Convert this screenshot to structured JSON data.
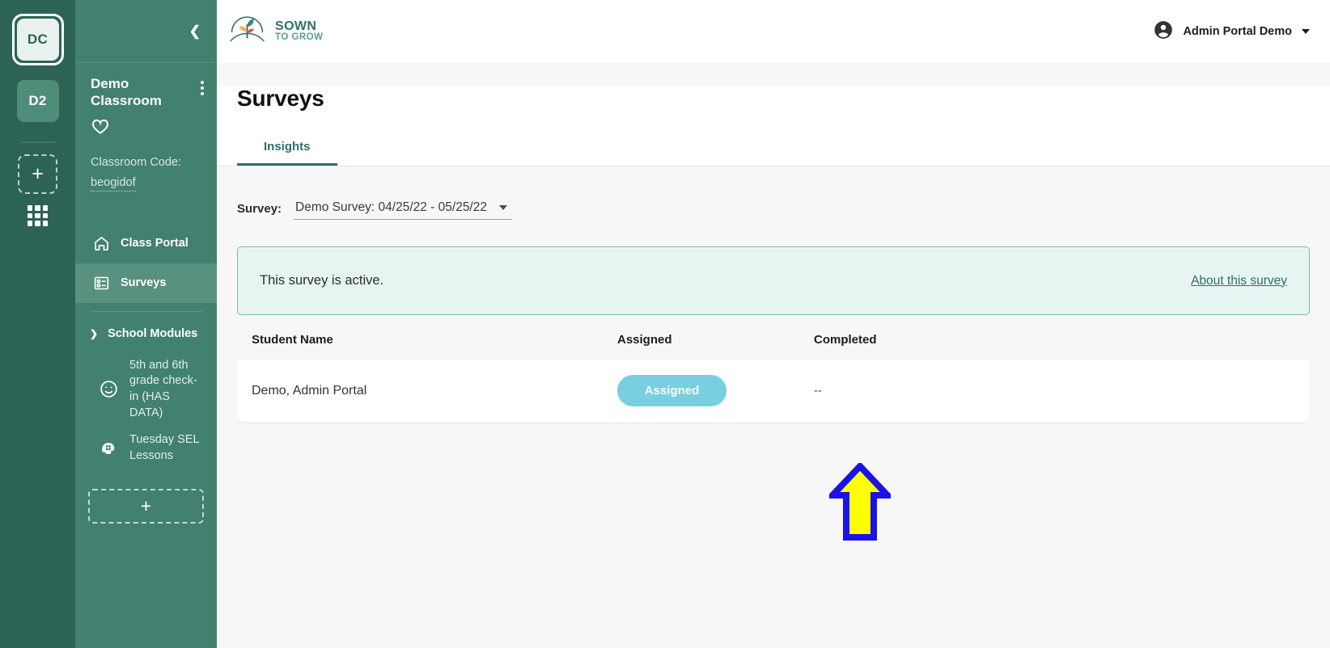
{
  "rail": {
    "accounts": [
      {
        "initials": "DC",
        "selected": true
      },
      {
        "initials": "D2",
        "selected": false
      }
    ],
    "add_label": "+",
    "grid_icon": "apps-grid-icon"
  },
  "sidebar": {
    "collapse_icon": "chevron-left-icon",
    "classroom_name": "Demo Classroom",
    "kebab_icon": "more-vertical-icon",
    "favorite_icon": "heart-icon",
    "code_label": "Classroom Code:",
    "code_value": "beogidof",
    "nav": [
      {
        "label": "Class Portal",
        "icon": "home-icon",
        "active": false
      },
      {
        "label": "Surveys",
        "icon": "survey-list-icon",
        "active": true
      }
    ],
    "modules_header": "School Modules",
    "modules_chevron": "chevron-down-icon",
    "modules": [
      {
        "label": "5th and 6th grade check-in (HAS DATA)",
        "icon": "smiley-face-icon"
      },
      {
        "label": "Tuesday SEL Lessons",
        "icon": "head-gear-icon"
      }
    ],
    "add_module_label": "+"
  },
  "topbar": {
    "logo_line1": "SOWN",
    "logo_line2": "TO GROW",
    "logo_icon": "sprout-logo-icon",
    "user_icon": "account-circle-icon",
    "user_name": "Admin Portal Demo",
    "user_caret": "caret-down-icon"
  },
  "page": {
    "title": "Surveys",
    "tabs": [
      {
        "label": "Insights",
        "active": true
      }
    ]
  },
  "survey_selector": {
    "label": "Survey:",
    "value": "Demo Survey: 04/25/22 - 05/25/22",
    "caret_icon": "caret-down-icon"
  },
  "banner": {
    "message": "This survey is active.",
    "link_label": "About this survey"
  },
  "table": {
    "columns": [
      "Student Name",
      "Assigned",
      "Completed"
    ],
    "rows": [
      {
        "student_name": "Demo, Admin Portal",
        "assigned": "Assigned",
        "completed": "--"
      }
    ]
  },
  "annotation": {
    "arrow_icon": "up-arrow-annotation",
    "fill_color": "#ffff00",
    "stroke_color": "#1a12e8"
  },
  "colors": {
    "rail_bg": "#2d6355",
    "sidebar_bg": "#42806f",
    "sidebar_active": "#58917f",
    "brand_teal": "#2f7167",
    "pill_blue": "#77cfdf",
    "banner_bg": "#e7f5f2",
    "page_bg": "#f7f7f7"
  }
}
